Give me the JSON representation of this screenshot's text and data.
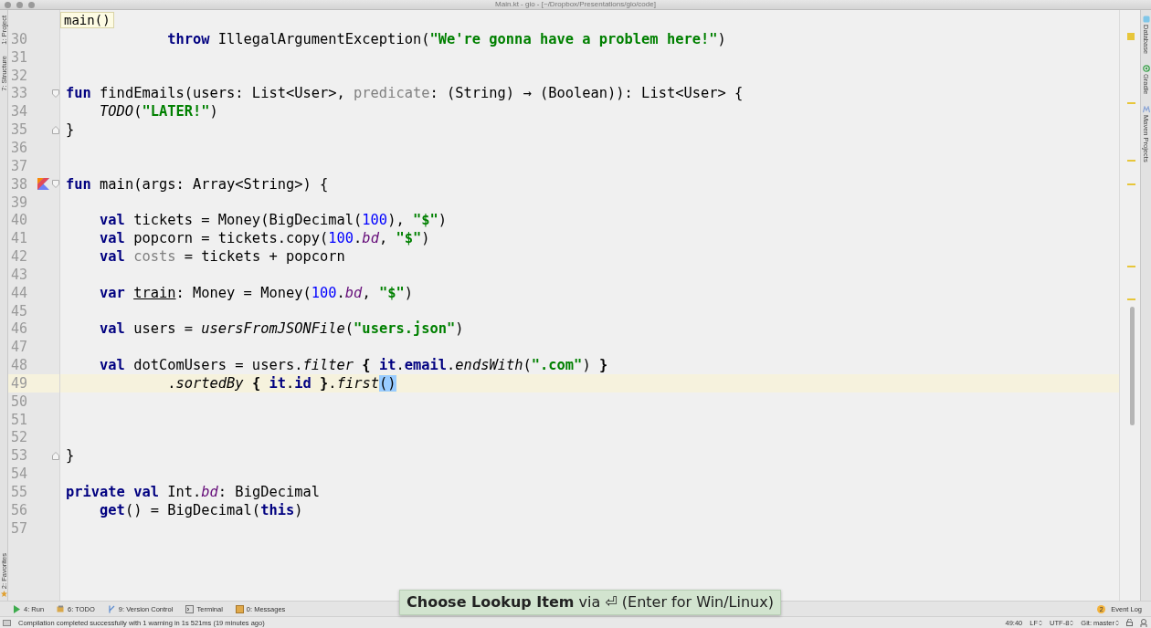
{
  "window": {
    "title": "Main.kt - gio - [~/Dropbox/Presentations/gio/code]"
  },
  "left_stripe": [
    {
      "label": "1: Project",
      "kind": "top"
    },
    {
      "label": "7: Structure",
      "kind": "top"
    },
    {
      "label": "2: Favorites",
      "kind": "bottom"
    }
  ],
  "right_stripe": [
    {
      "label": "Database",
      "kind": "database"
    },
    {
      "label": "Gradle",
      "kind": "gradle"
    },
    {
      "label": "Maven Projects",
      "kind": "maven"
    }
  ],
  "breadcrumb": "main()",
  "lines": [
    {
      "number": "30",
      "current": false,
      "kind": "plain",
      "tokens": [
        {
          "text": "            throw",
          "kind": "keyword"
        },
        {
          "text": " IllegalArgumentException("
        },
        {
          "text": "\"We're gonna have a problem here!\"",
          "kind": "string"
        },
        {
          "text": ")"
        }
      ]
    },
    {
      "number": "31",
      "current": false,
      "kind": "plain"
    },
    {
      "number": "32",
      "current": false,
      "kind": "plain"
    },
    {
      "number": "33",
      "current": false,
      "kind": "fold_start",
      "tokens": [
        {
          "text": "fun",
          "kind": "keyword"
        },
        {
          "text": " findEmails(users: List<User>, "
        },
        {
          "text": "predicate",
          "kind": "unused"
        },
        {
          "text": ": (String) → (Boolean)): List<User> {"
        }
      ]
    },
    {
      "number": "34",
      "current": false,
      "kind": "plain",
      "tokens": [
        {
          "text": "    TODO",
          "kind": "call"
        },
        {
          "text": "("
        },
        {
          "text": "\"LATER!\"",
          "kind": "string"
        },
        {
          "text": ")"
        }
      ]
    },
    {
      "number": "35",
      "current": false,
      "kind": "fold_end",
      "tokens": [
        {
          "text": "}"
        }
      ]
    },
    {
      "number": "36",
      "current": false,
      "kind": "plain"
    },
    {
      "number": "37",
      "current": false,
      "kind": "plain"
    },
    {
      "number": "38",
      "current": false,
      "kind": "run_fold_start",
      "tokens": [
        {
          "text": "fun",
          "kind": "keyword"
        },
        {
          "text": " main(args: Array<String>) {"
        }
      ]
    },
    {
      "number": "39",
      "current": false,
      "kind": "plain"
    },
    {
      "number": "40",
      "current": false,
      "kind": "plain",
      "tokens": [
        {
          "text": "    val",
          "kind": "keyword"
        },
        {
          "text": " tickets = Money(BigDecimal("
        },
        {
          "text": "100",
          "kind": "number"
        },
        {
          "text": "), "
        },
        {
          "text": "\"$\"",
          "kind": "string"
        },
        {
          "text": ")"
        }
      ]
    },
    {
      "number": "41",
      "current": false,
      "kind": "plain",
      "tokens": [
        {
          "text": "    val",
          "kind": "keyword"
        },
        {
          "text": " popcorn = tickets.copy("
        },
        {
          "text": "100",
          "kind": "number"
        },
        {
          "text": "."
        },
        {
          "text": "bd",
          "kind": "extension"
        },
        {
          "text": ", "
        },
        {
          "text": "\"$\"",
          "kind": "string"
        },
        {
          "text": ")"
        }
      ]
    },
    {
      "number": "42",
      "current": false,
      "kind": "plain",
      "tokens": [
        {
          "text": "    val ",
          "kind": "keyword"
        },
        {
          "text": "costs",
          "kind": "unused"
        },
        {
          "text": " = tickets + popcorn"
        }
      ]
    },
    {
      "number": "43",
      "current": false,
      "kind": "plain"
    },
    {
      "number": "44",
      "current": false,
      "kind": "plain",
      "tokens": [
        {
          "text": "    var ",
          "kind": "keyword"
        },
        {
          "text": "train",
          "kind": "reassigned"
        },
        {
          "text": ": Money = Money("
        },
        {
          "text": "100",
          "kind": "number"
        },
        {
          "text": "."
        },
        {
          "text": "bd",
          "kind": "extension"
        },
        {
          "text": ", "
        },
        {
          "text": "\"$\"",
          "kind": "string"
        },
        {
          "text": ")"
        }
      ]
    },
    {
      "number": "45",
      "current": false,
      "kind": "plain"
    },
    {
      "number": "46",
      "current": false,
      "kind": "plain",
      "tokens": [
        {
          "text": "    val",
          "kind": "keyword"
        },
        {
          "text": " users = "
        },
        {
          "text": "usersFromJSONFile",
          "kind": "call"
        },
        {
          "text": "("
        },
        {
          "text": "\"users.json\"",
          "kind": "string"
        },
        {
          "text": ")"
        }
      ]
    },
    {
      "number": "47",
      "current": false,
      "kind": "plain"
    },
    {
      "number": "48",
      "current": false,
      "kind": "plain",
      "tokens": [
        {
          "text": "    val",
          "kind": "keyword"
        },
        {
          "text": " dotComUsers = users."
        },
        {
          "text": "filter ",
          "kind": "call"
        },
        {
          "text": "{ ",
          "kind": "brace"
        },
        {
          "text": "it",
          "kind": "keyword"
        },
        {
          "text": "."
        },
        {
          "text": "email",
          "kind": "keyword"
        },
        {
          "text": "."
        },
        {
          "text": "endsWith",
          "kind": "call"
        },
        {
          "text": "("
        },
        {
          "text": "\".com\"",
          "kind": "string"
        },
        {
          "text": ") "
        },
        {
          "text": "}",
          "kind": "brace"
        }
      ]
    },
    {
      "number": "49",
      "current": true,
      "kind": "plain",
      "tokens": [
        {
          "text": "            ."
        },
        {
          "text": "sortedBy ",
          "kind": "call"
        },
        {
          "text": "{ ",
          "kind": "brace"
        },
        {
          "text": "it",
          "kind": "keyword"
        },
        {
          "text": "."
        },
        {
          "text": "id ",
          "kind": "keyword"
        },
        {
          "text": "}",
          "kind": "brace"
        },
        {
          "text": "."
        },
        {
          "text": "first",
          "kind": "call"
        },
        {
          "text": "()",
          "kind": "match"
        }
      ]
    },
    {
      "number": "50",
      "current": false,
      "kind": "plain"
    },
    {
      "number": "51",
      "current": false,
      "kind": "plain"
    },
    {
      "number": "52",
      "current": false,
      "kind": "plain"
    },
    {
      "number": "53",
      "current": false,
      "kind": "fold_end",
      "tokens": [
        {
          "text": "}"
        }
      ]
    },
    {
      "number": "54",
      "current": false,
      "kind": "plain"
    },
    {
      "number": "55",
      "current": false,
      "kind": "plain",
      "tokens": [
        {
          "text": "private val",
          "kind": "keyword"
        },
        {
          "text": " Int."
        },
        {
          "text": "bd",
          "kind": "extension"
        },
        {
          "text": ": BigDecimal"
        }
      ]
    },
    {
      "number": "56",
      "current": false,
      "kind": "plain",
      "tokens": [
        {
          "text": "    get",
          "kind": "keyword"
        },
        {
          "text": "() = BigDecimal("
        },
        {
          "text": "this",
          "kind": "keyword"
        },
        {
          "text": ")"
        }
      ]
    },
    {
      "number": "57",
      "current": false,
      "kind": "plain"
    }
  ],
  "lookup_hint": "**Choose Lookup Item** via ⏎ (Enter for Win/Linux)",
  "tool_windows": [
    {
      "label": "4: Run",
      "kind": "run"
    },
    {
      "label": "6: TODO",
      "kind": "todo"
    },
    {
      "label": "9: Version Control",
      "kind": "vcs"
    },
    {
      "label": "Terminal",
      "kind": "terminal"
    },
    {
      "label": "0: Messages",
      "kind": "messages"
    }
  ],
  "event_log": {
    "label": "Event Log",
    "count": "2"
  },
  "status_bar": {
    "message": "Compilation completed successfully with 1 warning in 1s 521ms (19 minutes ago)",
    "position": "49:40",
    "line_separator": "LF",
    "encoding": "UTF-8",
    "vcs_branch": "Git: master"
  }
}
